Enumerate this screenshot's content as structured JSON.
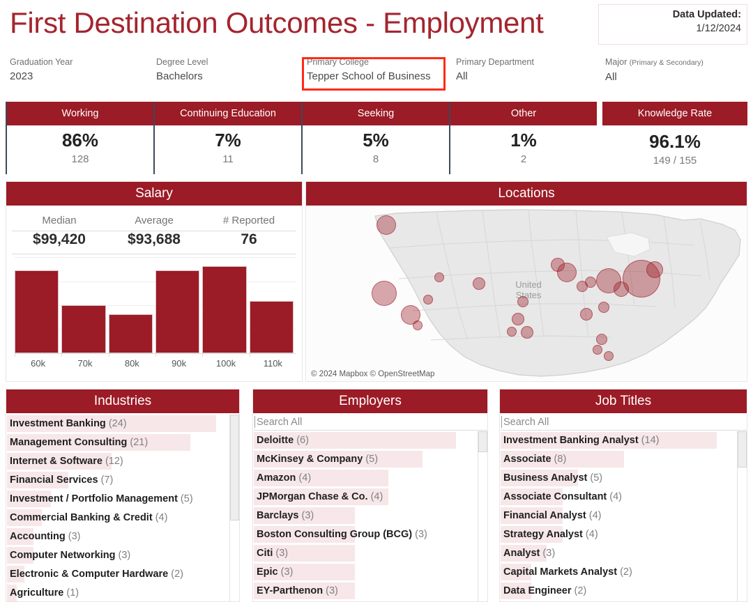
{
  "header": {
    "title": "First Destination Outcomes - Employment",
    "updated_label": "Data Updated:",
    "updated_value": "1/12/2024",
    "title_color": "#A4252E",
    "brand_red": "#9B1B26"
  },
  "filters": [
    {
      "label": "Graduation Year",
      "value": "2023"
    },
    {
      "label": "Degree Level",
      "value": "Bachelors"
    },
    {
      "label": "Primary College",
      "value": "Tepper School of Business",
      "highlighted": true
    },
    {
      "label": "Primary Department",
      "value": "All"
    },
    {
      "label": "Major ",
      "label_sub": "(Primary & Secondary)",
      "value": "All"
    }
  ],
  "kpis": [
    {
      "title": "Working",
      "percent": "86%",
      "count": "128"
    },
    {
      "title": "Continuing Education",
      "percent": "7%",
      "count": "11"
    },
    {
      "title": "Seeking",
      "percent": "5%",
      "count": "8"
    },
    {
      "title": "Other",
      "percent": "1%",
      "count": "2"
    }
  ],
  "knowledge_rate": {
    "title": "Knowledge Rate",
    "percent": "96.1%",
    "count": "149 / 155"
  },
  "salary": {
    "panel_title": "Salary",
    "stats": [
      {
        "label": "Median",
        "value": "$99,420"
      },
      {
        "label": "Average",
        "value": "$93,688"
      },
      {
        "label": "# Reported",
        "value": "76"
      }
    ]
  },
  "locations": {
    "panel_title": "Locations",
    "attribution": "© 2024 Mapbox © OpenStreetMap",
    "country_label_line1": "United",
    "country_label_line2": "States"
  },
  "industries": {
    "panel_title": "Industries",
    "items": [
      {
        "label": "Investment Banking",
        "count": 24
      },
      {
        "label": "Management Consulting",
        "count": 21
      },
      {
        "label": "Internet & Software",
        "count": 12
      },
      {
        "label": "Financial Services",
        "count": 7
      },
      {
        "label": "Investment / Portfolio Management",
        "count": 5
      },
      {
        "label": "Commercial Banking & Credit",
        "count": 4
      },
      {
        "label": "Accounting",
        "count": 3
      },
      {
        "label": "Computer Networking",
        "count": 3
      },
      {
        "label": "Electronic & Computer Hardware",
        "count": 2
      },
      {
        "label": "Agriculture",
        "count": 1
      }
    ]
  },
  "employers": {
    "panel_title": "Employers",
    "search_placeholder": "Search All",
    "items": [
      {
        "label": "Deloitte",
        "count": 6
      },
      {
        "label": "McKinsey & Company",
        "count": 5
      },
      {
        "label": "Amazon",
        "count": 4
      },
      {
        "label": "JPMorgan Chase & Co.",
        "count": 4
      },
      {
        "label": "Barclays",
        "count": 3
      },
      {
        "label": "Boston Consulting Group (BCG)",
        "count": 3
      },
      {
        "label": "Citi",
        "count": 3
      },
      {
        "label": "Epic",
        "count": 3
      },
      {
        "label": "EY-Parthenon",
        "count": 3
      }
    ]
  },
  "job_titles": {
    "panel_title": "Job Titles",
    "search_placeholder": "Search All",
    "items": [
      {
        "label": "Investment Banking Analyst",
        "count": 14
      },
      {
        "label": "Associate",
        "count": 8
      },
      {
        "label": "Business Analyst",
        "count": 5
      },
      {
        "label": "Associate Consultant",
        "count": 4
      },
      {
        "label": "Financial Analyst",
        "count": 4
      },
      {
        "label": "Strategy Analyst",
        "count": 4
      },
      {
        "label": "Analyst",
        "count": 3
      },
      {
        "label": "Capital Markets Analyst",
        "count": 2
      },
      {
        "label": "Data Engineer",
        "count": 2
      }
    ]
  },
  "chart_data": [
    {
      "type": "bar",
      "title": "Salary",
      "xlabel": "",
      "ylabel": "",
      "categories": [
        "60k",
        "70k",
        "80k",
        "90k",
        "100k",
        "110k"
      ],
      "values": [
        19,
        11,
        9,
        19,
        20,
        12
      ],
      "ylim": [
        0,
        22
      ],
      "grid": true,
      "legend": "none",
      "bar_color": "#9B1B26",
      "note": "Salary distribution histogram; bin counts estimated from bar heights"
    },
    {
      "type": "scatter",
      "title": "Locations",
      "projection": "united-states-map",
      "note": "Proportional-symbol map of employment locations; bubble area scales with count",
      "points": [
        {
          "x": 18.0,
          "y": 10.5,
          "size": 13,
          "label": "Seattle WA"
        },
        {
          "x": 17.5,
          "y": 49.5,
          "size": 17,
          "label": "San Francisco Bay Area CA"
        },
        {
          "x": 23.5,
          "y": 62.0,
          "size": 13,
          "label": "Los Angeles CA"
        },
        {
          "x": 25.0,
          "y": 68.0,
          "size": 6,
          "label": "San Diego CA"
        },
        {
          "x": 27.5,
          "y": 53.0,
          "size": 6,
          "label": "Phoenix AZ"
        },
        {
          "x": 30.0,
          "y": 40.5,
          "size": 6,
          "label": "Salt Lake City UT"
        },
        {
          "x": 39.0,
          "y": 44.0,
          "size": 8,
          "label": "Denver CO"
        },
        {
          "x": 49.0,
          "y": 54.5,
          "size": 7,
          "label": "Dallas TX"
        },
        {
          "x": 48.0,
          "y": 64.5,
          "size": 8,
          "label": "Austin TX"
        },
        {
          "x": 46.5,
          "y": 71.5,
          "size": 6,
          "label": "San Antonio TX"
        },
        {
          "x": 50.0,
          "y": 72.0,
          "size": 8,
          "label": "Houston TX"
        },
        {
          "x": 57.0,
          "y": 33.0,
          "size": 9,
          "label": "Milwaukee WI"
        },
        {
          "x": 59.0,
          "y": 37.5,
          "size": 13,
          "label": "Chicago IL"
        },
        {
          "x": 62.5,
          "y": 45.5,
          "size": 7,
          "label": "Indianapolis IN"
        },
        {
          "x": 64.5,
          "y": 43.0,
          "size": 7,
          "label": "Columbus OH"
        },
        {
          "x": 68.5,
          "y": 42.5,
          "size": 17,
          "label": "Pittsburgh PA"
        },
        {
          "x": 71.5,
          "y": 47.0,
          "size": 10,
          "label": "Washington DC"
        },
        {
          "x": 76.0,
          "y": 41.0,
          "size": 26,
          "label": "New York NY"
        },
        {
          "x": 79.0,
          "y": 36.0,
          "size": 11,
          "label": "Boston MA"
        },
        {
          "x": 67.5,
          "y": 57.5,
          "size": 7,
          "label": "Charlotte NC"
        },
        {
          "x": 63.5,
          "y": 61.5,
          "size": 8,
          "label": "Atlanta GA"
        },
        {
          "x": 67.0,
          "y": 76.0,
          "size": 7,
          "label": "Orlando FL"
        },
        {
          "x": 66.0,
          "y": 82.0,
          "size": 6,
          "label": "Tampa FL"
        },
        {
          "x": 68.5,
          "y": 85.5,
          "size": 6,
          "label": "Miami FL"
        }
      ]
    }
  ]
}
